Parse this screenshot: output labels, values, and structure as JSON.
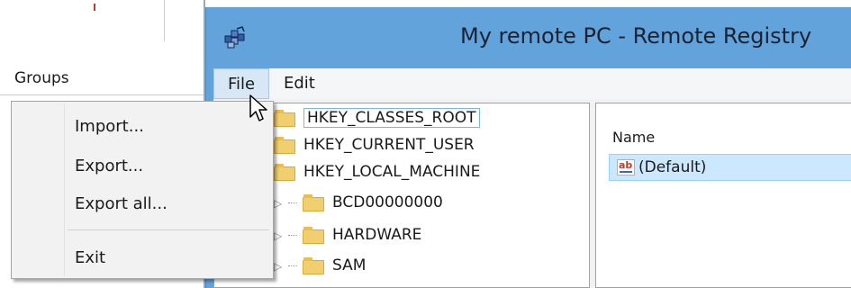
{
  "background_window": {
    "groups_label": "Groups"
  },
  "registry_window": {
    "title": "My remote PC - Remote Registry",
    "menu": {
      "file": "File",
      "edit": "Edit"
    },
    "tree": [
      {
        "label": "HKEY_CLASSES_ROOT",
        "level": 0,
        "selected": true
      },
      {
        "label": "HKEY_CURRENT_USER",
        "level": 0
      },
      {
        "label": "HKEY_LOCAL_MACHINE",
        "level": 0
      },
      {
        "label": "BCD00000000",
        "level": 1
      },
      {
        "label": "HARDWARE",
        "level": 1
      },
      {
        "label": "SAM",
        "level": 1
      }
    ],
    "values_pane": {
      "column_name": "Name",
      "rows": [
        {
          "name": "(Default)",
          "icon": "string-value-icon"
        }
      ]
    }
  },
  "file_menu": {
    "items": [
      "Import...",
      "Export...",
      "Export all...",
      "Exit"
    ]
  },
  "colors": {
    "title_bar": "#63a3dc",
    "selection": "#cce8ff",
    "menu_bg": "#f2f2f2"
  }
}
